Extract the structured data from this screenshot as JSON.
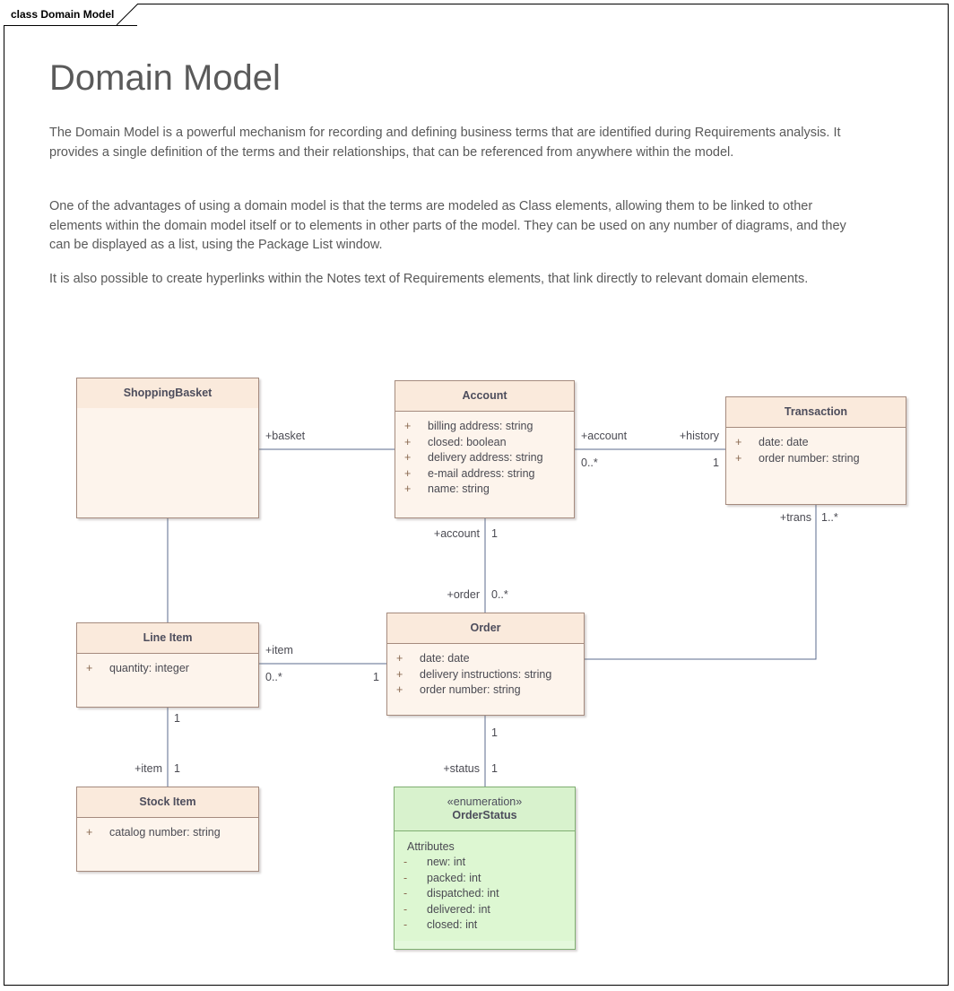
{
  "frame": {
    "label": "class Domain Model"
  },
  "header": {
    "title": "Domain Model",
    "paragraphs": [
      "The Domain Model is a powerful mechanism for recording and defining business terms that are identified during Requirements analysis.  It provides a single definition of the terms and their relationships, that can be referenced from anywhere within the model.",
      "One of the advantages of using a domain model is that the terms are modeled as Class elements, allowing them to be linked to other elements within the domain model itself or to elements in other parts of the model.  They can be used on any number of diagrams, and they can be displayed as a list, using the Package List window.",
      "It is also possible to create hyperlinks within the Notes text of Requirements elements, that link directly to relevant domain elements."
    ]
  },
  "diagram": {
    "type": "uml-class-diagram",
    "colors": {
      "class_fill": "#fdf4ec",
      "class_header_fill": "#faeadc",
      "class_border": "#a58b7e",
      "enum_fill": "#ddf7d2",
      "enum_header_fill": "#d8f2cd",
      "enum_border": "#7fae71",
      "connector": "#5b6b8c",
      "text": "#4a4a52"
    },
    "classes": [
      {
        "id": "shoppingbasket",
        "name": "ShoppingBasket",
        "stereotype": "",
        "attributes": []
      },
      {
        "id": "account",
        "name": "Account",
        "stereotype": "",
        "attributes": [
          {
            "visibility": "+",
            "text": "billing address: string"
          },
          {
            "visibility": "+",
            "text": "closed: boolean"
          },
          {
            "visibility": "+",
            "text": "delivery address: string"
          },
          {
            "visibility": "+",
            "text": "e-mail address: string"
          },
          {
            "visibility": "+",
            "text": "name: string"
          }
        ]
      },
      {
        "id": "transaction",
        "name": "Transaction",
        "stereotype": "",
        "attributes": [
          {
            "visibility": "+",
            "text": "date: date"
          },
          {
            "visibility": "+",
            "text": "order number: string"
          }
        ]
      },
      {
        "id": "lineitem",
        "name": "Line Item",
        "stereotype": "",
        "attributes": [
          {
            "visibility": "+",
            "text": "quantity: integer"
          }
        ]
      },
      {
        "id": "order",
        "name": "Order",
        "stereotype": "",
        "attributes": [
          {
            "visibility": "+",
            "text": "date: date"
          },
          {
            "visibility": "+",
            "text": "delivery instructions: string"
          },
          {
            "visibility": "+",
            "text": "order number: string"
          }
        ]
      },
      {
        "id": "stockitem",
        "name": "Stock Item",
        "stereotype": "",
        "attributes": [
          {
            "visibility": "+",
            "text": "catalog number: string"
          }
        ]
      },
      {
        "id": "orderstatus",
        "name": "OrderStatus",
        "stereotype": "«enumeration»",
        "section_label": "Attributes",
        "attributes": [
          {
            "visibility": "-",
            "text": "new: int"
          },
          {
            "visibility": "-",
            "text": "packed: int"
          },
          {
            "visibility": "-",
            "text": "dispatched: int"
          },
          {
            "visibility": "-",
            "text": "delivered: int"
          },
          {
            "visibility": "-",
            "text": "closed: int"
          }
        ]
      }
    ],
    "associations": [
      {
        "id": "basket-account",
        "from": "shoppingbasket",
        "to": "account",
        "role_label": "+basket",
        "multiplicity": ""
      },
      {
        "id": "account-transaction",
        "from": "account",
        "to": "transaction",
        "source_role": "+account",
        "source_multiplicity": "0..*",
        "target_role": "+history",
        "target_multiplicity": "1"
      },
      {
        "id": "account-order",
        "from": "account",
        "to": "order",
        "source_role": "+account",
        "source_multiplicity": "1",
        "target_role": "+order",
        "target_multiplicity": "0..*"
      },
      {
        "id": "transaction-order",
        "from": "transaction",
        "to": "order",
        "source_role": "+trans",
        "source_multiplicity": "1..*"
      },
      {
        "id": "lineitem-order",
        "from": "lineitem",
        "to": "order",
        "source_role": "+item",
        "source_multiplicity": "0..*",
        "target_multiplicity": "1"
      },
      {
        "id": "lineitem-stockitem",
        "from": "lineitem",
        "to": "stockitem",
        "source_multiplicity": "1",
        "target_role": "+item",
        "target_multiplicity": "1"
      },
      {
        "id": "order-orderstatus",
        "from": "order",
        "to": "orderstatus",
        "source_multiplicity": "1",
        "target_role": "+status",
        "target_multiplicity": "1"
      }
    ]
  }
}
